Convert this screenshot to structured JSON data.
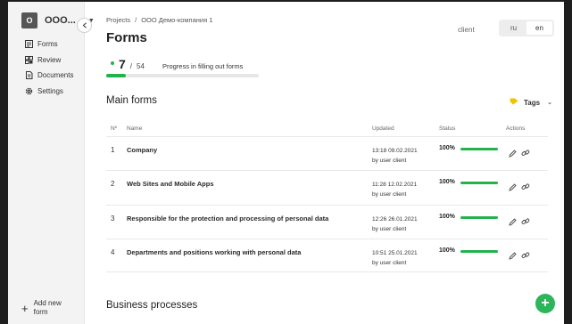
{
  "sidebar": {
    "org_initial": "O",
    "org_name": "OOO...",
    "items": [
      {
        "label": "Forms",
        "icon": "forms-icon"
      },
      {
        "label": "Review",
        "icon": "review-icon"
      },
      {
        "label": "Documents",
        "icon": "documents-icon"
      },
      {
        "label": "Settings",
        "icon": "gear-icon"
      }
    ],
    "add_new_label": "Add new form"
  },
  "breadcrumb": {
    "root": "Projects",
    "separator": "/",
    "current": "ООО Демо-компания 1"
  },
  "page_title": "Forms",
  "progress": {
    "done": "7",
    "total": "54",
    "label": "Progress in filling out forms",
    "fraction": 0.13,
    "color": "#22b24c"
  },
  "header": {
    "role": "client",
    "languages": [
      "ru",
      "en"
    ],
    "active_language": "en"
  },
  "main_forms": {
    "title": "Main forms",
    "tags_label": "Tags",
    "columns": {
      "num": "Nº",
      "name": "Name",
      "updated": "Updated",
      "status": "Status",
      "actions": "Actions"
    },
    "rows": [
      {
        "num": "1",
        "name": "Company",
        "updated": "13:18 09.02.2021",
        "by": "by user client",
        "status": "100%",
        "fill": 1.0
      },
      {
        "num": "2",
        "name": "Web Sites and Mobile Apps",
        "updated": "11:28 12.02.2021",
        "by": "by user client",
        "status": "100%",
        "fill": 1.0
      },
      {
        "num": "3",
        "name": "Responsible for the protection and processing of personal data",
        "updated": "12:26 26.01.2021",
        "by": "by user client",
        "status": "100%",
        "fill": 1.0
      },
      {
        "num": "4",
        "name": "Departments and positions working with personal data",
        "updated": "10:51 25.01.2021",
        "by": "by user client",
        "status": "100%",
        "fill": 1.0
      }
    ]
  },
  "business_processes": {
    "title": "Business processes"
  },
  "colors": {
    "accent": "#22b24c",
    "sidebar_bg": "#f3f3f3"
  }
}
